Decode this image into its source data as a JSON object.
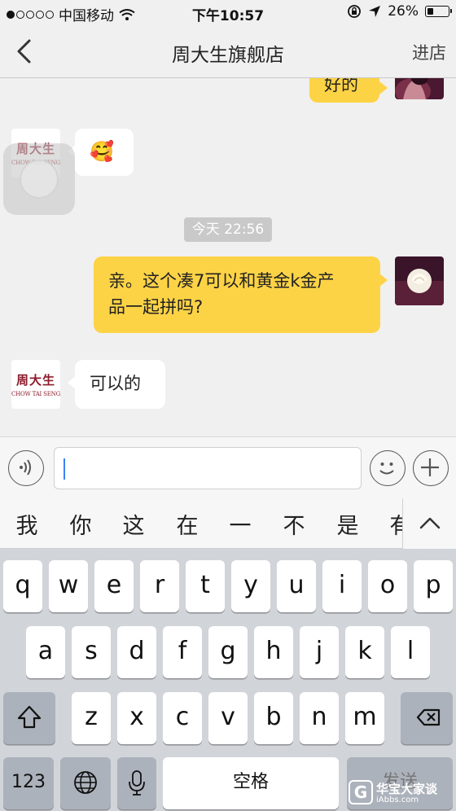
{
  "status_bar": {
    "carrier": "中国移动",
    "time": "下午10:57",
    "battery": "26%",
    "battery_level": 0.26
  },
  "nav": {
    "title": "周大生旗舰店",
    "enter_store": "进店"
  },
  "shop": {
    "logo_cn": "周大生",
    "logo_en": "CHOW TAI SENG"
  },
  "messages": {
    "m1_partial": "好的",
    "m2_emoji": "🥰",
    "timestamp": "今天 22:56",
    "m3_line1": "亲。这个凑7可以和黄金k金产",
    "m3_line2": "品一起拼吗?",
    "m4": "可以的"
  },
  "input": {
    "value": "",
    "placeholder": ""
  },
  "candidates": [
    "我",
    "你",
    "这",
    "在",
    "一",
    "不",
    "是",
    "有"
  ],
  "keyboard": {
    "row1": [
      "q",
      "w",
      "e",
      "r",
      "t",
      "y",
      "u",
      "i",
      "o",
      "p"
    ],
    "row2": [
      "a",
      "s",
      "d",
      "f",
      "g",
      "h",
      "j",
      "k",
      "l"
    ],
    "row3": [
      "z",
      "x",
      "c",
      "v",
      "b",
      "n",
      "m"
    ],
    "num_key": "123",
    "space_key": "空格",
    "send_key": "发送"
  },
  "watermark": {
    "title": "华宝大家谈",
    "url": "iAbbs.com"
  },
  "colors": {
    "out_bubble": "#fdd346",
    "brand": "#8b1b2b",
    "caret": "#3b82f6"
  },
  "icons": [
    "back-icon",
    "voice-icon",
    "emoji-icon",
    "plus-icon",
    "shift-icon",
    "delete-icon",
    "globe-icon",
    "mic-icon",
    "collapse-icon"
  ]
}
